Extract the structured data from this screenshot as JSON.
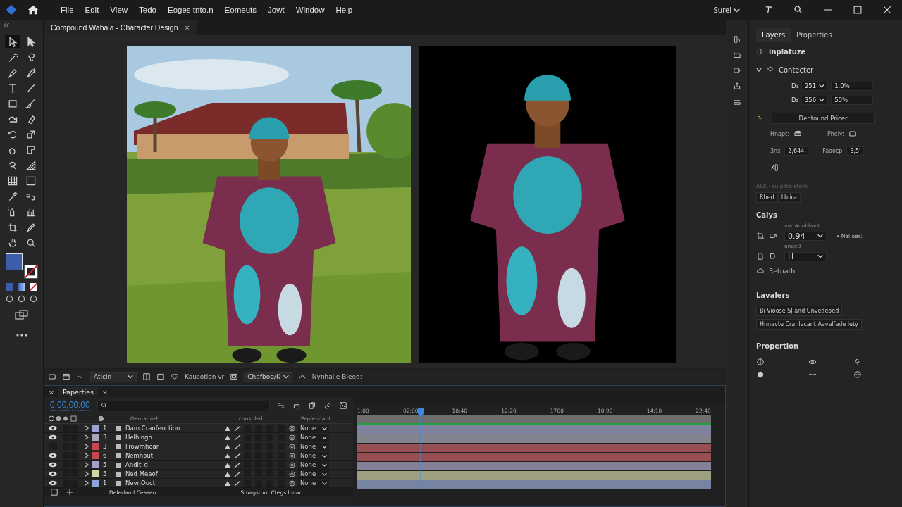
{
  "menu": {
    "items": [
      "File",
      "Edit",
      "View",
      "Tedo",
      "Eoges tnto.n",
      "Eomeuts",
      "Jowt",
      "Window",
      "Help"
    ]
  },
  "workspace": {
    "label": "Surei"
  },
  "document_tab": {
    "title": "Compound Wahala - Character Design",
    "close": "×"
  },
  "tools": [
    {
      "selected": true
    },
    {
      "selected": false
    },
    {
      "selected": false
    },
    {
      "selected": false
    },
    {
      "selected": false
    },
    {
      "selected": false
    },
    {
      "selected": false
    },
    {
      "selected": false
    },
    {
      "selected": false
    },
    {
      "selected": false
    },
    {
      "selected": false
    },
    {
      "selected": false
    },
    {
      "selected": false
    },
    {
      "selected": false
    },
    {
      "selected": false
    },
    {
      "selected": false
    },
    {
      "selected": false
    },
    {
      "selected": false
    },
    {
      "selected": false
    },
    {
      "selected": false
    },
    {
      "selected": false
    },
    {
      "selected": false
    },
    {
      "selected": false
    },
    {
      "selected": false
    },
    {
      "selected": false
    },
    {
      "selected": false
    },
    {
      "selected": false
    },
    {
      "selected": false
    }
  ],
  "canvas_bar": {
    "preset": "Aticin",
    "label_1": "Kausotion vr",
    "mode": "Chafbog/K",
    "label_2": "Nynhaile Bleed:"
  },
  "timeline": {
    "tab": "Paperties",
    "close": "×",
    "timecode": "0:00,00:00",
    "columns": [
      "Oentanaeh",
      "conspled",
      "Peplendant"
    ],
    "ruler": [
      "1:00",
      "02:00",
      "10:40",
      "12:20",
      "1700",
      "10:90",
      "14:10",
      "22:40"
    ],
    "playhead": {
      "level": 0.18
    },
    "layers": [
      {
        "number": "1",
        "name": "Dam Cranfenction",
        "color": "#9ea3d6",
        "visible": true,
        "parent": "None"
      },
      {
        "number": "3",
        "name": "Helhingh",
        "color": "#a6a6b8",
        "visible": true,
        "parent": "None"
      },
      {
        "number": "3",
        "name": "Frowmhoar",
        "color": "#c8464f",
        "visible": false,
        "parent": "None"
      },
      {
        "number": "6",
        "name": "Nemhout",
        "color": "#c8464f",
        "visible": true,
        "parent": "None"
      },
      {
        "number": "5",
        "name": "Andlt_d",
        "color": "#a89ecb",
        "visible": true,
        "parent": "None"
      },
      {
        "number": "5",
        "name": "Ned Meaof",
        "color": "#d6d6a0",
        "visible": true,
        "parent": "None"
      },
      {
        "number": "1",
        "name": "NevnOuct",
        "color": "#8ea4de",
        "visible": true,
        "parent": "None"
      }
    ],
    "footer": [
      "Delerland Ceasen",
      "Smagstunt Ctegs lonart"
    ]
  },
  "right_panel": {
    "tabs": [
      {
        "label": "Layers",
        "selected": true
      },
      {
        "label": "Properties",
        "selected": false
      }
    ],
    "heading": "inplatuze",
    "section": {
      "title": "Contecter",
      "expanded": true,
      "fields": [
        {
          "label": "D₁",
          "value": "251",
          "unit_value": "1.0%"
        },
        {
          "label": "D₂",
          "value": "356",
          "unit_value": "50%"
        }
      ],
      "button": "Dentound Pricer",
      "hnapt_label": "Hnapt:",
      "phely_label": "Phely:",
      "size": {
        "label": "3ns",
        "value": "2,644"
      },
      "factor": {
        "label": "Faoocp",
        "value": "3,5'"
      },
      "hint": "ASK · au pcks-stock",
      "tags": [
        "Rhed",
        "Lblira"
      ]
    },
    "calys": {
      "title": "Calys",
      "caption_1": "vor Aunhboot",
      "value_1": "0.94",
      "side_label": "• Nal oes:",
      "caption_2": "onge3",
      "value_2": "H",
      "item": "Retnath"
    },
    "lavalers": {
      "title": "Lavalers",
      "items": [
        "Bi Vioose SJ and Unvedeoed",
        "Hnnavte Cranlecant Aevelfade lety"
      ]
    },
    "propertion": {
      "title": "Propertion"
    }
  }
}
